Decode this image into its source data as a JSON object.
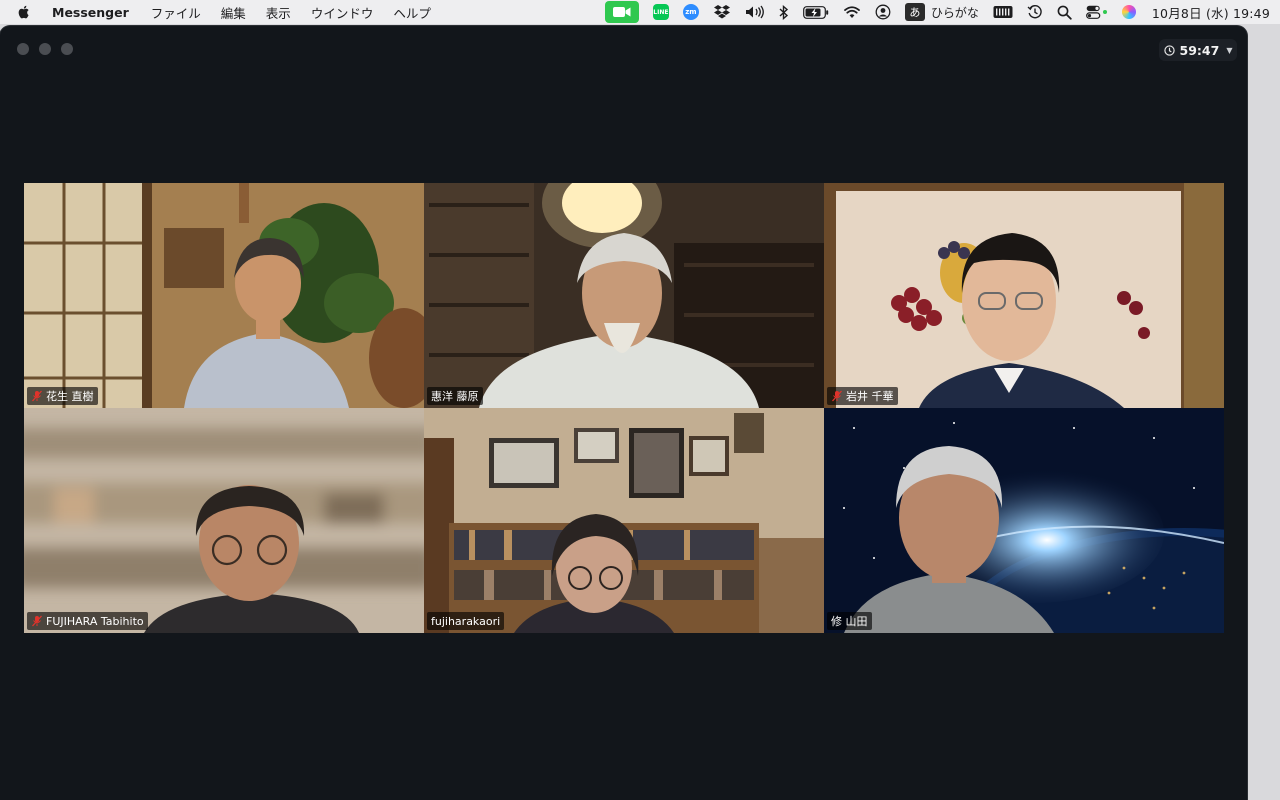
{
  "menubar": {
    "app_name": "Messenger",
    "menus": [
      "ファイル",
      "編集",
      "表示",
      "ウインドウ",
      "ヘルプ"
    ],
    "status_icons": [
      "facetime-camera-icon",
      "line-app-icon",
      "zoom-app-icon",
      "dropbox-icon",
      "volume-icon",
      "bluetooth-icon",
      "battery-icon",
      "wifi-icon",
      "user-account-icon",
      "ime-icon",
      "keyboard-icon",
      "time-machine-icon",
      "spotlight-search-icon",
      "control-center-icon",
      "siri-icon"
    ],
    "line_label": "LINE",
    "zoom_label": "zm",
    "ime_char": "あ",
    "ime_label": "ひらがな",
    "clock": "10月8日 (水)  19:49",
    "colors": {
      "camera_active": "#2fc84f"
    }
  },
  "window": {
    "call_timer": "59:47"
  },
  "participants": [
    {
      "name": "花生 直樹",
      "muted": true,
      "active_speaker": false,
      "scene": "japanese-room-with-plant"
    },
    {
      "name": "惠洋 藤原",
      "muted": false,
      "active_speaker": false,
      "scene": "library-with-pendant-lamp"
    },
    {
      "name": "岩井 千華",
      "muted": true,
      "active_speaker": false,
      "scene": "fruit-painting-background"
    },
    {
      "name": "FUJIHARA Tabihito",
      "muted": true,
      "active_speaker": false,
      "scene": "blurred-bookshelf"
    },
    {
      "name": "fujiharakaori",
      "muted": false,
      "active_speaker": false,
      "scene": "room-with-bookshelves-and-frames"
    },
    {
      "name": "修 山田",
      "muted": false,
      "active_speaker": true,
      "scene": "earth-from-space-background"
    }
  ],
  "colors": {
    "window_bg": "#12161b",
    "active_speaker_border": "#3ccf52",
    "muted_icon": "#e0332b"
  }
}
